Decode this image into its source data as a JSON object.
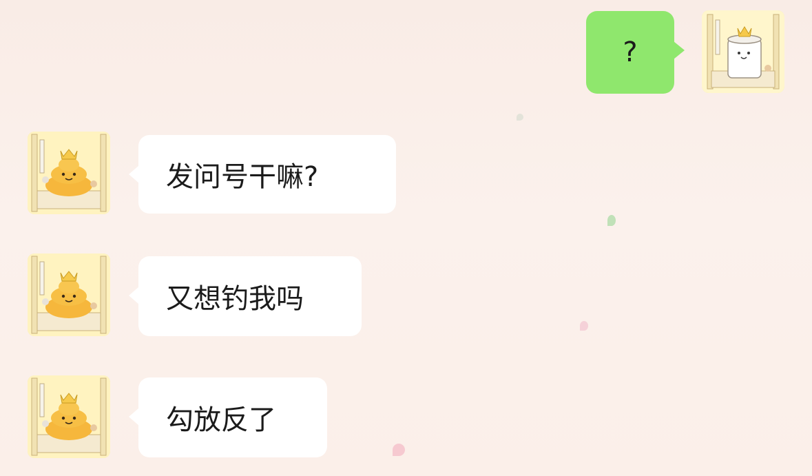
{
  "chat": {
    "messages": [
      {
        "sender": "me",
        "avatar_icon": "toilet-paper-king-avatar-icon",
        "text": "?"
      },
      {
        "sender": "other",
        "avatar_icon": "poop-king-avatar-icon",
        "text": "发问号干嘛?"
      },
      {
        "sender": "other",
        "avatar_icon": "poop-king-avatar-icon",
        "text": "又想钓我吗"
      },
      {
        "sender": "other",
        "avatar_icon": "poop-king-avatar-icon",
        "text": "勾放反了"
      }
    ]
  },
  "colors": {
    "background": "#fbefe9",
    "sent_bubble": "#8fe76d",
    "received_bubble": "#ffffff",
    "text": "#1b1b1b"
  }
}
